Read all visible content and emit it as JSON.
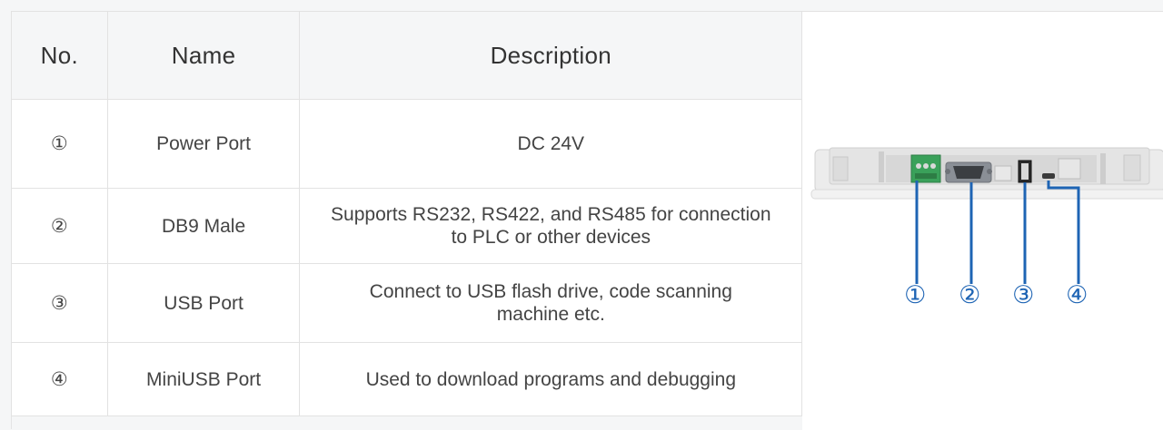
{
  "table": {
    "headers": {
      "no": "No.",
      "name": "Name",
      "description": "Description"
    },
    "rows": [
      {
        "no": "①",
        "name": "Power Port",
        "description": "DC 24V"
      },
      {
        "no": "②",
        "name": "DB9 Male",
        "description": "Supports RS232, RS422, and RS485 for connection to PLC or other devices"
      },
      {
        "no": "③",
        "name": "USB Port",
        "description": "Connect to USB flash drive, code scanning machine etc."
      },
      {
        "no": "④",
        "name": "MiniUSB Port",
        "description": "Used to download programs and debugging"
      }
    ]
  },
  "figure": {
    "callouts": [
      "①",
      "②",
      "③",
      "④"
    ],
    "callout_color": "#1e64b4",
    "port_colors": {
      "terminal_block": "#3aa15a",
      "db9_shell": "#8a8f96",
      "usb": "#2b2b2b"
    }
  }
}
